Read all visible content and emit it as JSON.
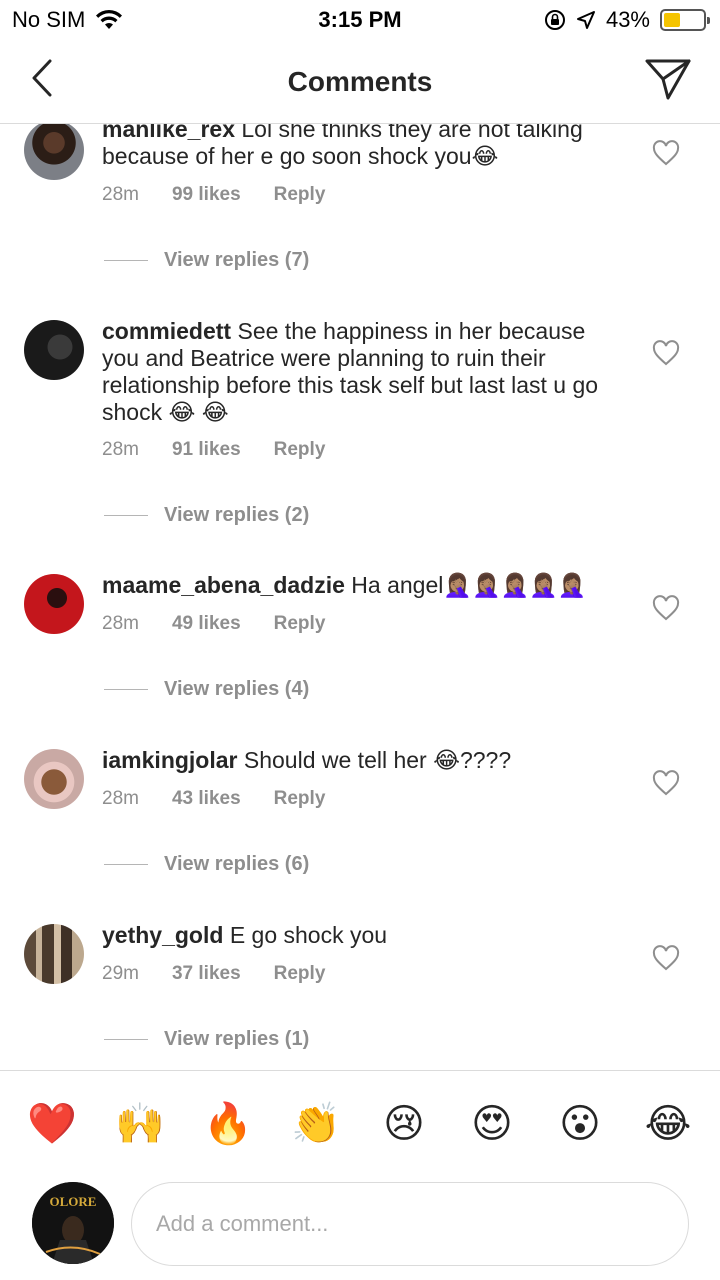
{
  "status_bar": {
    "carrier": "No SIM",
    "time": "3:15 PM",
    "battery": "43%",
    "battery_level": 0.43
  },
  "header": {
    "title": "Comments"
  },
  "comments": [
    {
      "username": "manlike_rex",
      "text": "Lol she thinks they are not talking because of her e go soon shock you😂",
      "time": "28m",
      "likes": "99 likes",
      "reply": "Reply",
      "view_replies": "View replies (7)"
    },
    {
      "username": "commiedett",
      "text": "See the happiness in her because you and Beatrice were planning to ruin their relationship before this task self but last last u go shock 😂 😂",
      "time": "28m",
      "likes": "91 likes",
      "reply": "Reply",
      "view_replies": "View replies (2)"
    },
    {
      "username": "maame_abena_dadzie",
      "text": "Ha angel🤦🏽‍♀️🤦🏽‍♀️🤦🏽‍♀️🤦🏽‍♀️🤦🏽‍♀️",
      "time": "28m",
      "likes": "49 likes",
      "reply": "Reply",
      "view_replies": "View replies (4)"
    },
    {
      "username": "iamkingjolar",
      "text": "Should we tell her 😂????",
      "time": "28m",
      "likes": "43 likes",
      "reply": "Reply",
      "view_replies": "View replies (6)"
    },
    {
      "username": "yethy_gold",
      "text": "E go shock you",
      "time": "29m",
      "likes": "37 likes",
      "reply": "Reply",
      "view_replies": "View replies (1)"
    }
  ],
  "emoji_bar": [
    "❤️",
    "🙌",
    "🔥",
    "👏",
    "😢",
    "😍",
    "😮",
    "😂"
  ],
  "comment_box": {
    "placeholder": "Add a comment...",
    "avatar_text": "OLORE"
  }
}
